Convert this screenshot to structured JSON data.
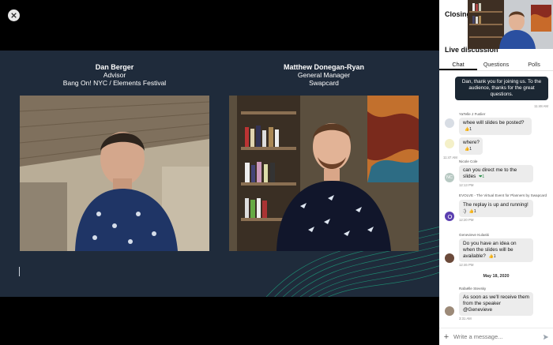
{
  "stage": {
    "close_label": "×",
    "speakers": [
      {
        "name": "Dan Berger",
        "role": "Advisor",
        "org": "Bang On! NYC / Elements Festival"
      },
      {
        "name": "Matthew Donegan-Ryan",
        "role": "General Manager",
        "org": "Swapcard"
      }
    ]
  },
  "panel": {
    "title": "Closing Berger",
    "section_title": "Live discussion",
    "tabs": [
      {
        "label": "Chat",
        "active": true
      },
      {
        "label": "Questions",
        "active": false
      },
      {
        "label": "Polls",
        "active": false
      }
    ],
    "own_message": {
      "text": "Dan, thank you for joining us. To the audience, thanks for the great questions.",
      "time": "11:48 AM"
    },
    "messages": [
      {
        "author": "YaTelle J Fuslier",
        "text": "whee will slides be posted?",
        "time": "",
        "reaction": "👍1"
      },
      {
        "author": "",
        "text": "where?",
        "time": "11:47 AM",
        "reaction": "👍1"
      },
      {
        "author": "Nicole Cole",
        "text": "can you direct me to the slides",
        "time": "12:13 PM",
        "reaction": "❤1",
        "avatar_initials": "NC"
      },
      {
        "author": "EVOLVE - The Virtual Event for Planners by Swapcard",
        "text": "The replay is up and running! :)",
        "time": "12:20 PM",
        "reaction": "👍1"
      },
      {
        "author": "Genevieve Kulaski",
        "text": "Do you have an idea on when the slides will be available?",
        "time": "12:46 PM",
        "reaction": "👍1"
      },
      {
        "author": "Rafaëlle Stevsky",
        "text": "As soon as we'll receive them from the speaker @Genevieve",
        "time": "3:31 AM",
        "reaction": ""
      }
    ],
    "date_separator": "May 18, 2020",
    "composer_placeholder": "Write a message...",
    "plus_label": "+"
  },
  "colors": {
    "slide_bg": "#1f2b3b",
    "own_bubble": "#1b2733",
    "accent_wave": "#1fa37f"
  },
  "icons": {
    "close": "close-icon",
    "send": "send-icon",
    "add": "plus-icon"
  }
}
